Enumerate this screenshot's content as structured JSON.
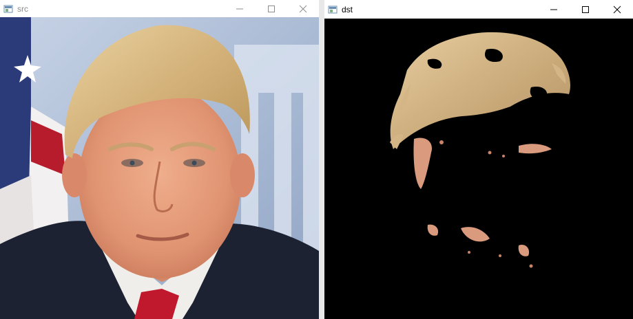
{
  "windows": {
    "src": {
      "title": "src"
    },
    "dst": {
      "title": "dst"
    }
  },
  "controls": {
    "minimize": "minimize",
    "maximize": "maximize",
    "close": "close"
  },
  "colors": {
    "titlebar": "#ffffff",
    "mask_background": "#000000",
    "skin": "#e09a7a",
    "hair": "#d8b77e",
    "suit": "#1d2233",
    "shirt": "#f0eeea",
    "tie": "#c0182c"
  }
}
